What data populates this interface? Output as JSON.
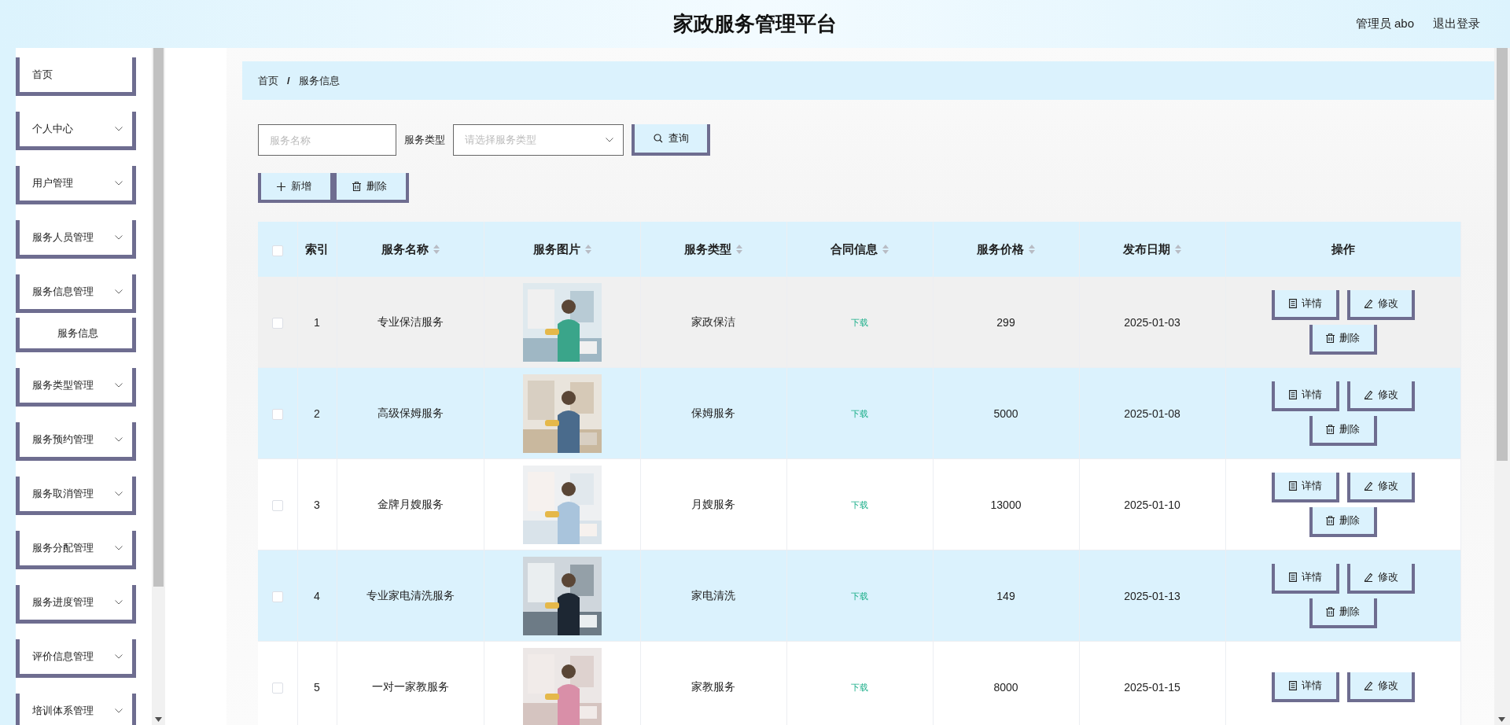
{
  "header": {
    "title": "家政服务管理平台",
    "user": "管理员 abo",
    "logout": "退出登录"
  },
  "sidebar": {
    "items": [
      {
        "label": "首页",
        "has_arrow": false
      },
      {
        "label": "个人中心",
        "has_arrow": true
      },
      {
        "label": "用户管理",
        "has_arrow": true
      },
      {
        "label": "服务人员管理",
        "has_arrow": true
      },
      {
        "label": "服务信息管理",
        "has_arrow": true,
        "children": [
          {
            "label": "服务信息"
          }
        ]
      },
      {
        "label": "服务类型管理",
        "has_arrow": true
      },
      {
        "label": "服务预约管理",
        "has_arrow": true
      },
      {
        "label": "服务取消管理",
        "has_arrow": true
      },
      {
        "label": "服务分配管理",
        "has_arrow": true
      },
      {
        "label": "服务进度管理",
        "has_arrow": true
      },
      {
        "label": "评价信息管理",
        "has_arrow": true
      },
      {
        "label": "培训体系管理",
        "has_arrow": true
      }
    ]
  },
  "breadcrumb": [
    {
      "label": "首页"
    },
    {
      "label": "服务信息"
    }
  ],
  "breadcrumb_separator": "/",
  "search": {
    "name_placeholder": "服务名称",
    "type_label": "服务类型",
    "type_placeholder": "请选择服务类型",
    "button": "查询"
  },
  "toolbar": [
    {
      "label": "新增",
      "kind": "add"
    },
    {
      "label": "删除",
      "kind": "delete"
    }
  ],
  "table": {
    "select_all": {
      "checked": false
    },
    "columns": [
      {
        "label": "索引",
        "sortable": false
      },
      {
        "label": "服务名称",
        "sortable": true
      },
      {
        "label": "服务图片",
        "sortable": true
      },
      {
        "label": "服务类型",
        "sortable": true
      },
      {
        "label": "合同信息",
        "sortable": true
      },
      {
        "label": "服务价格",
        "sortable": true
      },
      {
        "label": "发布日期",
        "sortable": true
      },
      {
        "label": "操作",
        "sortable": false
      }
    ],
    "rows": [
      {
        "checked": false,
        "hovered": true,
        "index": "1",
        "name": "专业保洁服务",
        "picture": {
          "kind": "picture"
        },
        "type": "家政保洁",
        "contract": "下载",
        "price": "299",
        "date": "2025-01-03",
        "actions": [
          {
            "label": "详情",
            "kind": "detail"
          },
          {
            "label": "修改",
            "kind": "edit"
          },
          {
            "label": "删除",
            "kind": "delete"
          }
        ]
      },
      {
        "checked": false,
        "hovered": false,
        "index": "2",
        "name": "高级保姆服务",
        "picture": {
          "kind": "picture"
        },
        "type": "保姆服务",
        "contract": "下载",
        "price": "5000",
        "date": "2025-01-08",
        "actions": [
          {
            "label": "详情",
            "kind": "detail"
          },
          {
            "label": "修改",
            "kind": "edit"
          },
          {
            "label": "删除",
            "kind": "delete"
          }
        ]
      },
      {
        "checked": false,
        "hovered": false,
        "index": "3",
        "name": "金牌月嫂服务",
        "picture": {
          "kind": "picture"
        },
        "type": "月嫂服务",
        "contract": "下载",
        "price": "13000",
        "date": "2025-01-10",
        "actions": [
          {
            "label": "详情",
            "kind": "detail"
          },
          {
            "label": "修改",
            "kind": "edit"
          },
          {
            "label": "删除",
            "kind": "delete"
          }
        ]
      },
      {
        "checked": false,
        "hovered": false,
        "index": "4",
        "name": "专业家电清洗服务",
        "picture": {
          "kind": "picture"
        },
        "type": "家电清洗",
        "contract": "下载",
        "price": "149",
        "date": "2025-01-13",
        "actions": [
          {
            "label": "详情",
            "kind": "detail"
          },
          {
            "label": "修改",
            "kind": "edit"
          },
          {
            "label": "删除",
            "kind": "delete"
          }
        ]
      },
      {
        "checked": false,
        "hovered": false,
        "index": "5",
        "name": "一对一家教服务",
        "picture": {
          "kind": "picture"
        },
        "type": "家教服务",
        "contract": "下载",
        "price": "8000",
        "date": "2025-01-15",
        "actions": [
          {
            "label": "详情",
            "kind": "detail"
          },
          {
            "label": "修改",
            "kind": "edit"
          }
        ]
      }
    ]
  }
}
